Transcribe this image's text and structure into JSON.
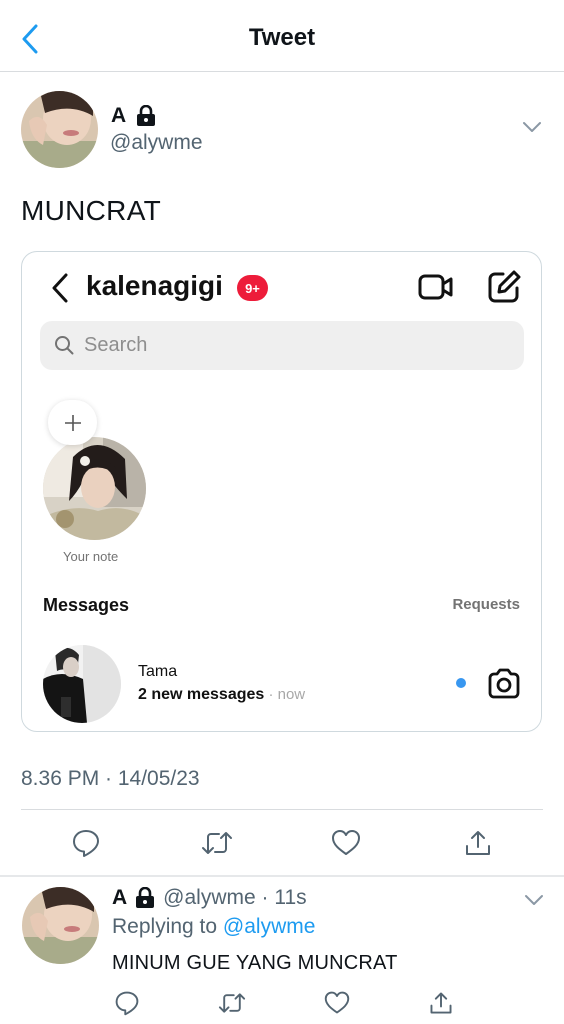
{
  "nav": {
    "title": "Tweet"
  },
  "tweet": {
    "author_name": "A",
    "author_handle": "@alywme",
    "text": "MUNCRAT",
    "timestamp": "8.36 PM · 14/05/23"
  },
  "instagram": {
    "username": "kalenagigi",
    "badge": "9+",
    "search_placeholder": "Search",
    "note_label": "Your note",
    "messages_title": "Messages",
    "requests_label": "Requests",
    "thread": {
      "name": "Tama",
      "preview": "2 new messages",
      "time": " · now"
    }
  },
  "reply": {
    "author_name": "A",
    "meta": "@alywme · 11s",
    "replying_prefix": "Replying to ",
    "replying_handle": "@alywme",
    "text": "MINUM GUE YANG MUNCRAT"
  },
  "colors": {
    "accent": "#1d9bf0",
    "secondary_text": "#536471",
    "badge": "#ed1c3a",
    "unread_dot": "#3897f0"
  },
  "icons": {
    "back": "chevron-left-icon",
    "lock": "lock-icon",
    "more": "chevron-down-icon",
    "reply": "speech-bubble-icon",
    "retweet": "retweet-icon",
    "like": "heart-icon",
    "share": "share-icon"
  }
}
